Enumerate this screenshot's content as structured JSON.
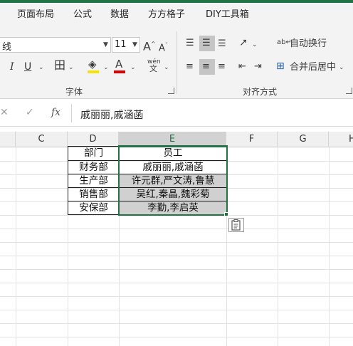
{
  "menu": {
    "tabs": [
      "页面布局",
      "公式",
      "数据",
      "方方格子",
      "DIY工具箱"
    ]
  },
  "ribbon": {
    "font_name": "线",
    "font_size": "11",
    "grow_font": "A",
    "shrink_font": "A",
    "italic": "I",
    "underline": "U",
    "phonetic": "wén",
    "phonetic_sub": "文",
    "wrap_text_label": "自动换行",
    "merge_center_label": "合并后居中",
    "group_font": "字体",
    "group_alignment": "对齐方式",
    "fill_color": "#f5e400",
    "font_color": "#e00000"
  },
  "formula_bar": {
    "cancel": "✕",
    "enter": "✓",
    "fx": "fx",
    "value": "戚丽丽,戚涵菡"
  },
  "columns": [
    "C",
    "D",
    "E",
    "F",
    "G",
    "H"
  ],
  "table": {
    "header": {
      "dept": "部门",
      "staff": "员工"
    },
    "rows": [
      {
        "dept": "财务部",
        "staff": "戚丽丽,戚涵菡"
      },
      {
        "dept": "生产部",
        "staff": "许元群,严文涛,鲁慧"
      },
      {
        "dept": "销售部",
        "staff": "吴红,秦晶,魏彩菊"
      },
      {
        "dept": "安保部",
        "staff": "李勤,李启英"
      }
    ]
  }
}
